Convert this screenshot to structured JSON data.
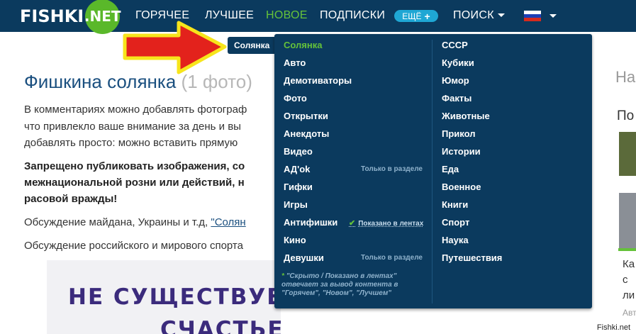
{
  "nav": {
    "logo_main": "FISHKI",
    "logo_badge": ".NET",
    "items": [
      {
        "label": "ГОРЯЧЕЕ",
        "active": false
      },
      {
        "label": "ЛУЧШЕЕ",
        "active": false
      },
      {
        "label": "НОВОЕ",
        "active": true
      },
      {
        "label": "ПОДПИСКИ",
        "active": false
      }
    ],
    "more_label": "ЕЩЁ",
    "more_plus": "+",
    "search_label": "ПОИСК",
    "flag_icon": "russia-flag-icon",
    "flag_colors": [
      "#ffffff",
      "#1c3fb6",
      "#d52b1e"
    ]
  },
  "tooltip": {
    "label": "Солянка"
  },
  "page": {
    "title": "Фишкина солянка",
    "title_count": "(1 фото)",
    "para1_line1": "В комментариях можно добавлять фотограф",
    "para1_line2": "что привлекло ваше внимание за день и вы",
    "para1_line3": "добавлять просто: можно вставить прямую",
    "warning_line1": "Запрещено публиковать изображения, со",
    "warning_line2": "межнациональной розни или действий, н",
    "warning_line3": "расовой вражды!",
    "discussion1_text": "Обсуждение майдана, Украины и т.д, ",
    "discussion1_link": "\"Солян",
    "discussion2_text": "Обсуждение российского и мирового спорта",
    "poster_line1": "НЕ СУЩЕСТВУЕ",
    "poster_line2": "СЧАСТЬЕ И ЕСТЬ ПУТЬ"
  },
  "right_col": {
    "t1": "На",
    "t2": "По",
    "t3": "Ка",
    "t4": "с",
    "t5": "ли",
    "t6": "Авт"
  },
  "menu": {
    "left_items": [
      {
        "label": "Солянка",
        "active": true,
        "note": ""
      },
      {
        "label": "Авто",
        "active": false,
        "note": ""
      },
      {
        "label": "Демотиваторы",
        "active": false,
        "note": ""
      },
      {
        "label": "Фото",
        "active": false,
        "note": ""
      },
      {
        "label": "Открытки",
        "active": false,
        "note": ""
      },
      {
        "label": "Анекдоты",
        "active": false,
        "note": ""
      },
      {
        "label": "Видео",
        "active": false,
        "note": ""
      },
      {
        "label": "АД'ok",
        "active": false,
        "note": "Только в разделе"
      },
      {
        "label": "Гифки",
        "active": false,
        "note": ""
      },
      {
        "label": "Игры",
        "active": false,
        "note": ""
      },
      {
        "label": "Антифишки",
        "active": false,
        "note": "Показано в лентах"
      },
      {
        "label": "Кино",
        "active": false,
        "note": ""
      },
      {
        "label": "Девушки",
        "active": false,
        "note": "Только в разделе"
      }
    ],
    "right_items": [
      "СССР",
      "Кубики",
      "Юмор",
      "Факты",
      "Животные",
      "Прикол",
      "Истории",
      "Еда",
      "Военное",
      "Книги",
      "Спорт",
      "Наука",
      "Путешествия"
    ],
    "footnote_line1": "\"Скрыто / Показано в лентах\"",
    "footnote_line2": "отвечает за вывод контента в",
    "footnote_line3": "\"Горячем\", \"Новом\", \"Лучшем\"",
    "footnote_star": "*"
  },
  "colors": {
    "accent_green": "#65c23a",
    "nav_bg": "#0b3a5e",
    "arrow_red": "#e3221c",
    "arrow_yellow": "#f7e51b"
  },
  "watermark": "Fishki.net"
}
